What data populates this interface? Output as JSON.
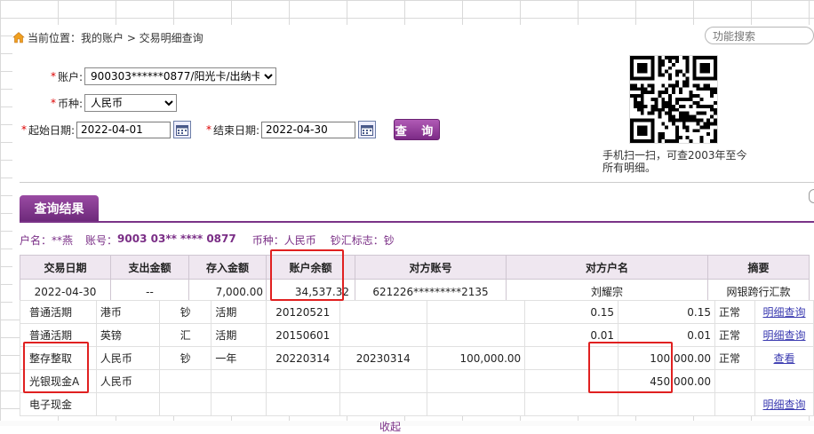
{
  "breadcrumb": {
    "text": "当前位置：我的账户 > 交易明细查询"
  },
  "search": {
    "placeholder": "功能搜索"
  },
  "form": {
    "account_label": "账户:",
    "account_value": "900303******0877/阳光卡/出纳卡",
    "currency_label": "币种:",
    "currency_value": "人民币",
    "start_label": "起始日期:",
    "start_value": "2022-04-01",
    "end_label": "结束日期:",
    "end_value": "2022-04-30",
    "query_label": "查 询"
  },
  "qr": {
    "caption": "手机扫一扫，可查2003年至今所有明细。"
  },
  "results": {
    "tab_label": "查询结果",
    "info": {
      "name_label": "户名：",
      "name_value": "**燕",
      "acct_label": "账号：",
      "acct_value": "9003 03** **** 0877",
      "currency_label": "币种：",
      "currency_value": "人民币",
      "flag_label": "钞汇标志：",
      "flag_value": "钞"
    },
    "columns": [
      "交易日期",
      "支出金额",
      "存入金额",
      "账户余额",
      "对方账号",
      "对方户名",
      "摘要"
    ],
    "rows": [
      {
        "date": "2022-04-30",
        "out": "--",
        "in": "7,000.00",
        "balance": "34,537.32",
        "cp_acct": "621226*********2135",
        "cp_name": "刘耀宗",
        "summary": "网银跨行汇款"
      }
    ]
  },
  "deposits": [
    {
      "type": "普通活期",
      "currency": "港币",
      "cash": "钞",
      "term": "活期",
      "open": "20120521",
      "due": "",
      "amount": "",
      "balance": "0.15",
      "avail": "0.15",
      "status": "正常",
      "action": "明细查询"
    },
    {
      "type": "普通活期",
      "currency": "英镑",
      "cash": "汇",
      "term": "活期",
      "open": "20150601",
      "due": "",
      "amount": "",
      "balance": "0.01",
      "avail": "0.01",
      "status": "正常",
      "action": "明细查询"
    },
    {
      "type": "整存整取",
      "currency": "人民币",
      "cash": "钞",
      "term": "一年",
      "open": "20220314",
      "due": "20230314",
      "amount": "100,000.00",
      "balance": "",
      "avail": "100,000.00",
      "status": "正常",
      "action": "查看"
    },
    {
      "type": "光银现金A",
      "currency": "人民币",
      "cash": "",
      "term": "",
      "open": "",
      "due": "",
      "amount": "",
      "balance": "",
      "avail": "450,000.00",
      "status": "",
      "action": ""
    },
    {
      "type": "电子现金",
      "currency": "",
      "cash": "",
      "term": "",
      "open": "",
      "due": "",
      "amount": "",
      "balance": "",
      "avail": "",
      "status": "",
      "action": "明细查询"
    }
  ],
  "bottom": {
    "partial_text": "收起"
  }
}
